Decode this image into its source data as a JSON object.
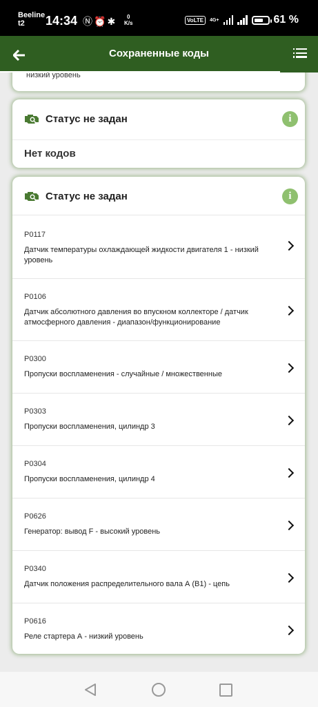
{
  "status_bar": {
    "carrier": "Beeline",
    "carrier_sub": "t2",
    "time": "14:34",
    "icons": [
      "nfc-icon",
      "alarm-icon",
      "bluetooth-icon"
    ],
    "net_speed_value": "0",
    "net_speed_unit": "K/s",
    "volte": "VoLTE",
    "network": "4G+",
    "battery_percent": "61 %",
    "battery_level": 0.61
  },
  "appbar": {
    "title": "Сохраненные коды",
    "back_icon": "arrow-left-icon",
    "menu_icon": "list-icon"
  },
  "colors": {
    "appbar": "#2f5e21",
    "accent": "#8fc06f",
    "background": "#ececec"
  },
  "top_partial": {
    "text": "низкий уровень"
  },
  "card_1": {
    "title": "Статус не задан",
    "no_codes": "Нет кодов"
  },
  "card_2": {
    "title": "Статус не задан",
    "codes": [
      {
        "code": "P0117",
        "description": "Датчик температуры охлаждающей жидкости двигателя 1 - низкий уровень"
      },
      {
        "code": "P0106",
        "description": "Датчик абсолютного давления во впускном коллекторе / датчик атмосферного давления - диапазон/функционирование"
      },
      {
        "code": "P0300",
        "description": "Пропуски воспламенения - случайные / множественные"
      },
      {
        "code": "P0303",
        "description": "Пропуски воспламенения, цилиндр 3"
      },
      {
        "code": "P0304",
        "description": "Пропуски воспламенения, цилиндр 4"
      },
      {
        "code": "P0626",
        "description": "Генератор: вывод F - высокий уровень"
      },
      {
        "code": "P0340",
        "description": "Датчик положения распределительного вала А (В1) - цепь"
      },
      {
        "code": "P0616",
        "description": "Реле стартера А - низкий уровень"
      }
    ]
  },
  "navbar": {
    "icons": [
      "nav-back-icon",
      "nav-home-icon",
      "nav-recents-icon"
    ]
  }
}
